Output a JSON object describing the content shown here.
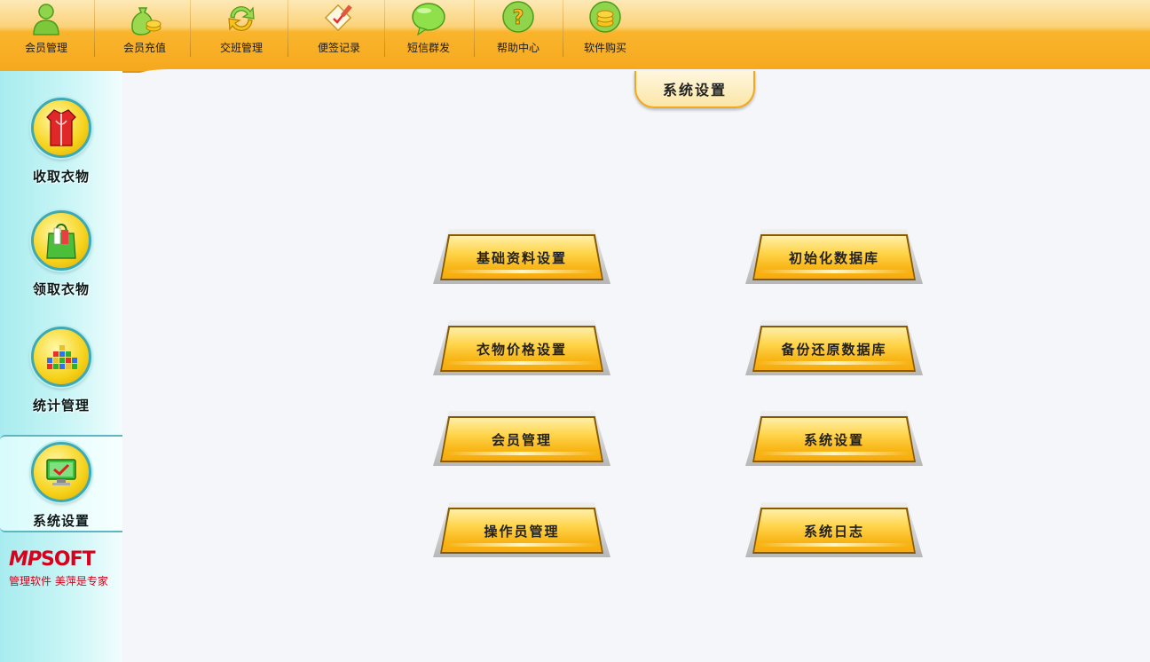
{
  "toolbar": {
    "items": [
      {
        "label": "会员管理",
        "icon": "member-person-icon"
      },
      {
        "label": "会员充值",
        "icon": "money-bag-coins-icon"
      },
      {
        "label": "交班管理",
        "icon": "refresh-arrows-icon"
      },
      {
        "label": "便签记录",
        "icon": "note-pencil-icon"
      },
      {
        "label": "短信群发",
        "icon": "speech-bubble-icon"
      },
      {
        "label": "帮助中心",
        "icon": "help-question-icon"
      },
      {
        "label": "软件购买",
        "icon": "coin-stack-icon"
      }
    ]
  },
  "active_tab": {
    "label": "系统设置"
  },
  "sidebar": {
    "items": [
      {
        "label": "收取衣物",
        "icon": "garment-icon"
      },
      {
        "label": "领取衣物",
        "icon": "shopping-bag-icon"
      },
      {
        "label": "统计管理",
        "icon": "bar-chart-icon"
      },
      {
        "label": "系统设置",
        "icon": "monitor-check-icon"
      }
    ],
    "logo": {
      "brand_a": "MP",
      "brand_b": "SOFT",
      "tagline": "管理软件 美萍是专家"
    }
  },
  "main": {
    "buttons": [
      {
        "label": "基础资料设置"
      },
      {
        "label": "初始化数据库"
      },
      {
        "label": "衣物价格设置"
      },
      {
        "label": "备份还原数据库"
      },
      {
        "label": "会员管理"
      },
      {
        "label": "系统设置"
      },
      {
        "label": "操作员管理"
      },
      {
        "label": "系统日志"
      }
    ]
  },
  "colors": {
    "toolbar": "#f6a81e",
    "sidebar": "#a8ecef",
    "button_face": "#f8b516",
    "brand": "#d8001a"
  }
}
